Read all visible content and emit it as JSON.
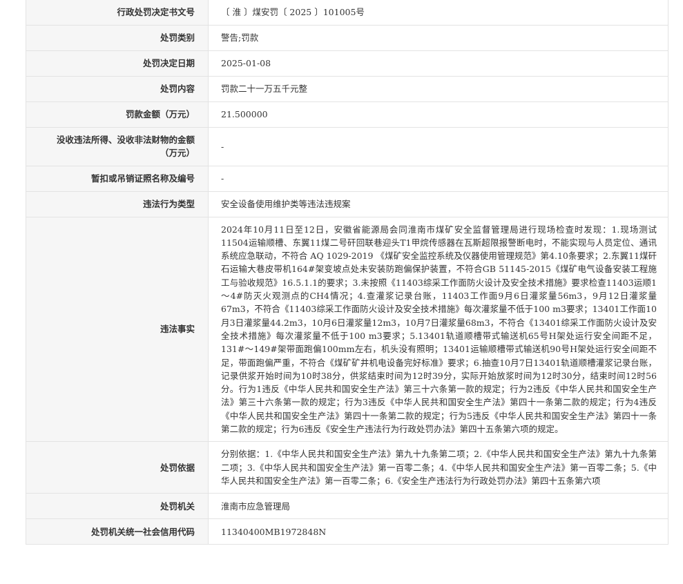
{
  "rows": [
    {
      "label": "行政处罚决定书文号",
      "value": "〔 淮 〕煤安罚〔 2025 〕101005号"
    },
    {
      "label": "处罚类别",
      "value": "警告;罚款"
    },
    {
      "label": "处罚决定日期",
      "value": "2025-01-08"
    },
    {
      "label": "处罚内容",
      "value": "罚款二十一万五千元整"
    },
    {
      "label": "罚款金额（万元）",
      "value": "21.500000"
    },
    {
      "label": "没收违法所得、没收非法财物的金额（万元）",
      "value": "-"
    },
    {
      "label": "暂扣或吊销证照名称及编号",
      "value": "-"
    },
    {
      "label": "违法行为类型",
      "value": "安全设备使用维护类等违法违规案"
    },
    {
      "label": "违法事实",
      "value": "2024年10月11日至12日，安徽省能源局会同淮南市煤矿安全监督管理局进行现场检查时发现：1.现场测试11504运输顺槽、东翼11煤二号矸回联巷迎头T1甲烷传感器在瓦斯超限报警断电时，不能实现与人员定位、通讯系统应急联动，不符合 AQ 1029-2019 《煤矿安全监控系统及仪器使用管理规范》第4.10条要求；2.东翼11煤矸石运输大巷皮带机164#架变坡点处未安装防跑偏保护装置，不符合GB 51145-2015《煤矿电气设备安装工程施工与验收规范》16.5.1.1的要求；3.未按照《11403综采工作面防火设计及安全技术措施》要求检查11403运顺1～4#防灭火观测点的CH4情况；4.查灌浆记录台账，11403工作面9月6日灌浆量56m3，9月12日灌浆量67m3，不符合《11403综采工作面防火设计及安全技术措施》每次灌浆量不低于100 m3要求；13401工作面10月3日灌浆量44.2m3，10月6日灌浆量12m3，10月7日灌浆量68m3，不符合《13401综采工作面防火设计及安全技术措施》每次灌浆量不低于100 m3要求；5.13401轨道顺槽带式输送机65号H架处运行安全间距不足，131#～149#架带面跑偏100mm左右，机头没有照明；13401运输顺槽带式输送机90号H架处运行安全间距不足，带面跑偏严重，不符合《煤矿矿井机电设备完好标准》要求；6.抽查10月7日13401轨道顺槽灌浆记录台账，记录供浆开始时间为10时38分，供浆结束时间为12时39分，实际开始放浆时间为12时30分，结束时间12时56分。行为1违反《中华人民共和国安全生产法》第三十六条第一款的规定；行为2违反《中华人民共和国安全生产法》第三十六条第一款的规定；行为3违反《中华人民共和国安全生产法》第四十一条第二款的规定；行为4违反《中华人民共和国安全生产法》第四十一条第二款的规定；行为5违反《中华人民共和国安全生产法》第四十一条第二款的规定；行为6违反《安全生产违法行为行政处罚办法》第四十五条第六项的规定。"
    },
    {
      "label": "处罚依据",
      "value": "分别依据：1.《中华人民共和国安全生产法》第九十九条第二项；2.《中华人民共和国安全生产法》第九十九条第二项；3.《中华人民共和国安全生产法》第一百零二条；4.《中华人民共和国安全生产法》第一百零二条；5.《中华人民共和国安全生产法》第一百零二条；6.《安全生产违法行为行政处罚办法》第四十五条第六项"
    },
    {
      "label": "处罚机关",
      "value": "淮南市应急管理局"
    },
    {
      "label": "处罚机关统一社会信用代码",
      "value": "11340400MB1972848N"
    }
  ]
}
